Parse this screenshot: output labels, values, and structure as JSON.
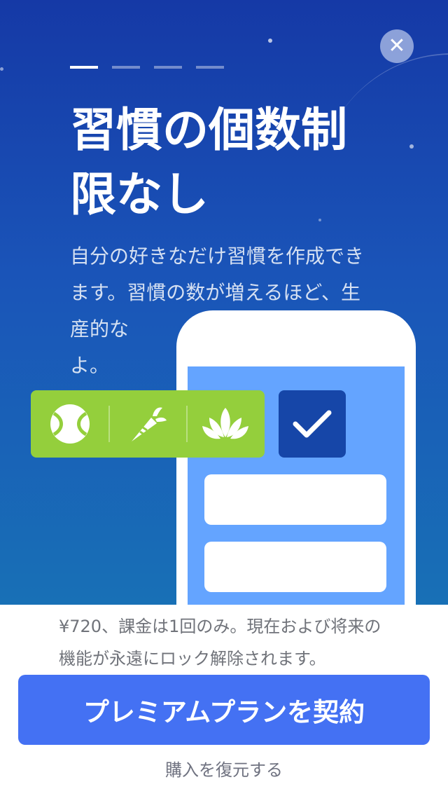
{
  "onboarding": {
    "close_icon": "close-icon",
    "pager": {
      "total": 4,
      "current": 1
    },
    "title": "習慣の個数制限なし",
    "description": "自分の好きなだけ習慣を作成できます。習慣の数が増えるほど、生産的な",
    "description_tail": "よ。"
  },
  "illustration": {
    "habit_icons": [
      "tennis-ball-icon",
      "carrot-icon",
      "lotus-icon"
    ],
    "check_icon": "checkmark-icon",
    "colors": {
      "habit_strip": "#94cf3c",
      "check_box": "#1646a8",
      "phone_screen": "#64a4ff"
    }
  },
  "purchase": {
    "price_text": "¥720、課金は1回のみ。現在および将来の機能が永遠にロック解除されます。",
    "cta_label": "プレミアムプランを契約",
    "restore_label": "購入を復元する",
    "accent_color": "#4471f3"
  }
}
